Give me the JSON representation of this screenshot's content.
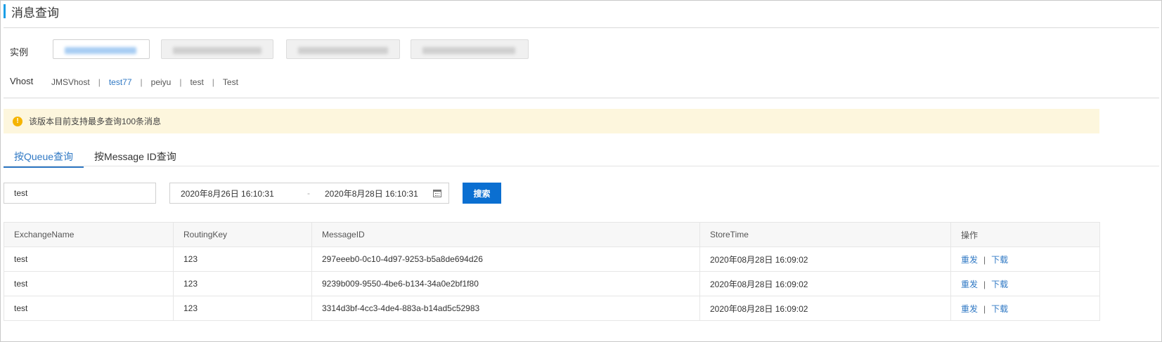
{
  "page": {
    "title": "消息查询"
  },
  "instance": {
    "label": "实例",
    "colors": {
      "active_bg": "#ffffff",
      "inactive_bg": "#f0f0f0",
      "blur_active": "#8fc0f0",
      "blur_inactive": "#c9c9c9"
    }
  },
  "vhost": {
    "label": "Vhost",
    "items": [
      "JMSVhost",
      "test77",
      "peiyu",
      "test",
      "Test"
    ],
    "selected": "test77",
    "separator": "|"
  },
  "notice": {
    "icon": "warning-icon",
    "text": "该版本目前支持最多查询100条消息"
  },
  "tabs": [
    {
      "label": "按Queue查询",
      "active": true
    },
    {
      "label": "按Message ID查询",
      "active": false
    }
  ],
  "search": {
    "queue_value": "test",
    "start_time": "2020年8月26日 16:10:31",
    "range_separator": "-",
    "end_time": "2020年8月28日 16:10:31",
    "button_label": "搜索"
  },
  "table": {
    "headers": [
      "ExchangeName",
      "RoutingKey",
      "MessageID",
      "StoreTime",
      "操作"
    ],
    "rows": [
      {
        "exchange": "test",
        "routing_key": "123",
        "message_id": "297eeeb0-0c10-4d97-9253-b5a8de694d26",
        "store_time": "2020年08月28日 16:09:02"
      },
      {
        "exchange": "test",
        "routing_key": "123",
        "message_id": "9239b009-9550-4be6-b134-34a0e2bf1f80",
        "store_time": "2020年08月28日 16:09:02"
      },
      {
        "exchange": "test",
        "routing_key": "123",
        "message_id": "3314d3bf-4cc3-4de4-883a-b14ad5c52983",
        "store_time": "2020年08月28日 16:09:02"
      }
    ],
    "op_resend": "重发",
    "op_download": "下载",
    "op_separator": "|"
  },
  "colors": {
    "accent": "#2f78c4",
    "primary_button": "#0b6fd1",
    "notice_bg": "#fdf6dd",
    "warning": "#f5b400"
  }
}
